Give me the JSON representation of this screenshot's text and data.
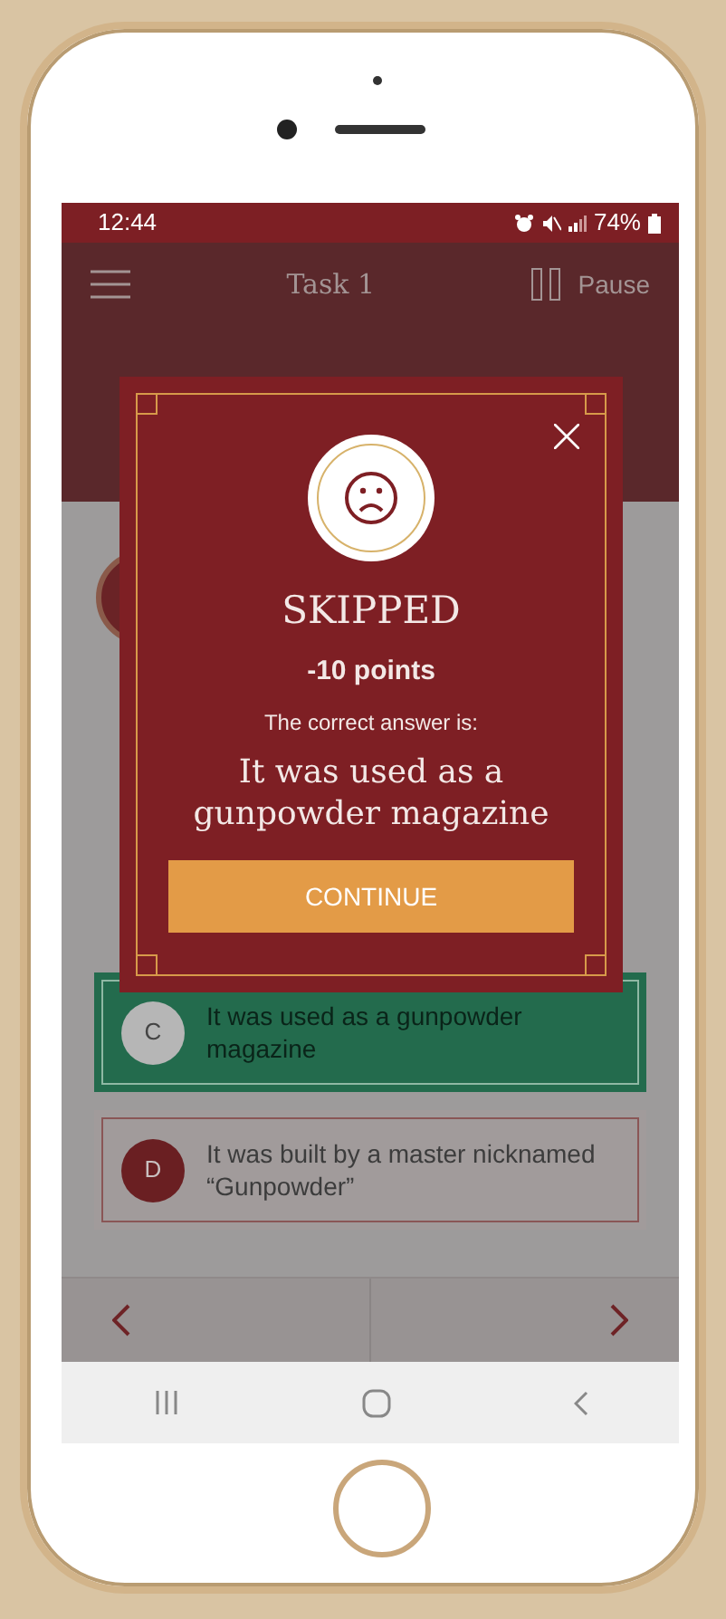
{
  "status_bar": {
    "time": "12:44",
    "battery": "74%"
  },
  "header": {
    "title": "Task 1",
    "pause": "Pause"
  },
  "answers": [
    {
      "letter": "C",
      "text": "It was used as a gunpowder magazine",
      "correct": true
    },
    {
      "letter": "D",
      "text": "It was built by a master nicknamed “Gunpowder”",
      "correct": false
    }
  ],
  "dialog": {
    "title": "SKIPPED",
    "points": "-10 points",
    "prompt": "The correct answer is:",
    "answer": "It was used as a gunpowder magazine",
    "button": "CONTINUE"
  }
}
